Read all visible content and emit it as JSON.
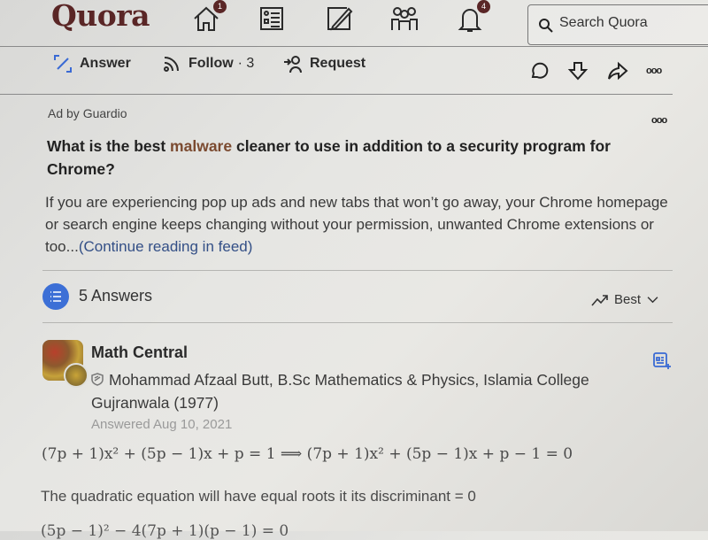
{
  "header": {
    "logo": "Quora",
    "nav": [
      {
        "name": "home-icon",
        "badge": "1"
      },
      {
        "name": "following-icon",
        "badge": null
      },
      {
        "name": "answer-icon",
        "badge": null
      },
      {
        "name": "spaces-icon",
        "badge": null
      },
      {
        "name": "notifications-icon",
        "badge": "4"
      }
    ],
    "search_placeholder": "Search Quora"
  },
  "actions": {
    "answer_label": "Answer",
    "follow_label": "Follow",
    "follow_count": "· 3",
    "request_label": "Request",
    "icons": [
      "comment-icon",
      "downvote-icon",
      "share-icon",
      "more-icon"
    ]
  },
  "ad": {
    "label": "Ad by Guardio",
    "title_before": "What is the best ",
    "title_highlight": "malware",
    "title_after": " cleaner to use in addition to a security program for Chrome?",
    "body": "If you are experiencing pop up ads and new tabs that won’t go away, your Chrome homepage or search engine keeps changing without your permission, unwanted Chrome extensions or too...",
    "link": "(Continue reading in feed)"
  },
  "answers": {
    "count_label": "5 Answers",
    "sort_label": "Best"
  },
  "answer": {
    "author": "Math Central",
    "credential": "Mohammad Afzaal Butt, B.Sc Mathematics & Physics, Islamia College Gujranwala (1977)",
    "date": "Answered Aug 10, 2021",
    "equation": "(7p + 1)x² + (5p − 1)x + p = 1 ⟹ (7p + 1)x² + (5p − 1)x + p − 1 = 0",
    "text": "The quadratic equation will have equal roots it its discriminant = 0",
    "cutoff": "(5p − 1)² − 4(7p + 1)(p − 1) = 0"
  }
}
